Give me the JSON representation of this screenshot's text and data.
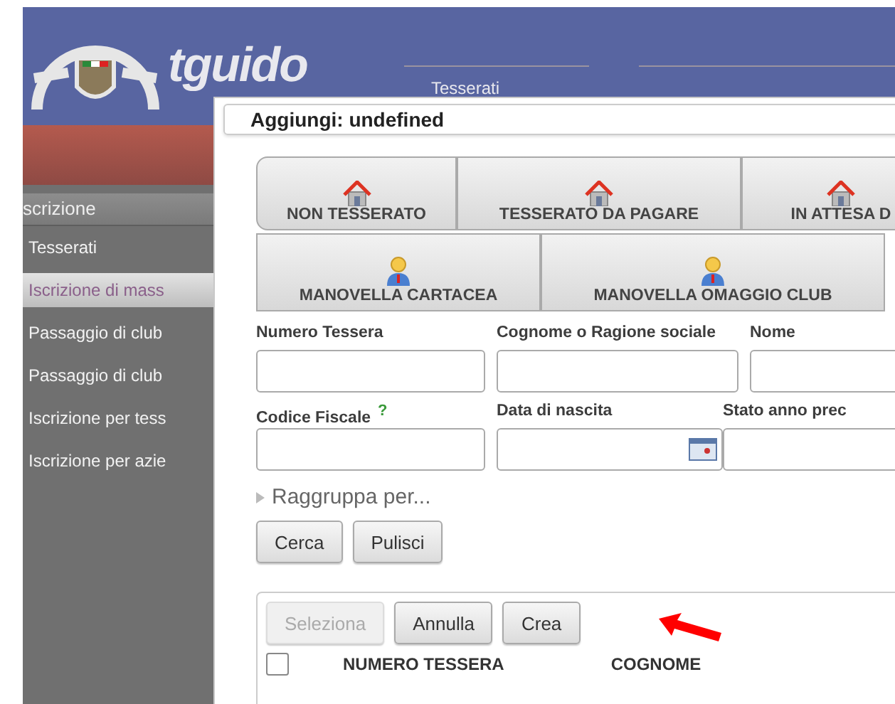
{
  "header": {
    "logo_text": "tguido",
    "menu_label": "Tesserati"
  },
  "sidebar": {
    "title": "scrizione",
    "items": [
      {
        "label": "Tesserati",
        "selected": false
      },
      {
        "label": "Iscrizione di mass",
        "selected": true
      },
      {
        "label": "Passaggio di club",
        "selected": false
      },
      {
        "label": "Passaggio di club",
        "selected": false
      },
      {
        "label": "Iscrizione per tess",
        "selected": false
      },
      {
        "label": "Iscrizione per azie",
        "selected": false
      }
    ]
  },
  "dialog": {
    "title": "Aggiungi: undefined",
    "type_buttons": [
      [
        {
          "label": "NON TESSERATO",
          "kind": "house"
        },
        {
          "label": "TESSERATO DA PAGARE",
          "kind": "house"
        },
        {
          "label": "IN ATTESA D",
          "kind": "house"
        }
      ],
      [
        {
          "label": "MANOVELLA CARTACEA",
          "kind": "person"
        },
        {
          "label": "MANOVELLA OMAGGIO CLUB",
          "kind": "person"
        }
      ]
    ],
    "fields": [
      [
        {
          "label": "Numero Tessera",
          "kind": "text"
        },
        {
          "label": "Cognome o Ragione sociale",
          "kind": "text"
        },
        {
          "label": "Nome",
          "kind": "text"
        }
      ],
      [
        {
          "label": "Codice Fiscale",
          "kind": "text",
          "help": "?"
        },
        {
          "label": "Data di nascita",
          "kind": "date"
        },
        {
          "label": "Stato anno prec",
          "kind": "text"
        }
      ]
    ],
    "group_by": "Raggruppa per...",
    "search_buttons": [
      "Cerca",
      "Pulisci"
    ],
    "table": {
      "actions": [
        {
          "label": "Seleziona",
          "disabled": true
        },
        {
          "label": "Annulla",
          "disabled": false
        },
        {
          "label": "Crea",
          "disabled": false
        }
      ],
      "select_all": {
        "checked": false
      },
      "columns": [
        "NUMERO TESSERA",
        "COGNOME"
      ]
    }
  }
}
